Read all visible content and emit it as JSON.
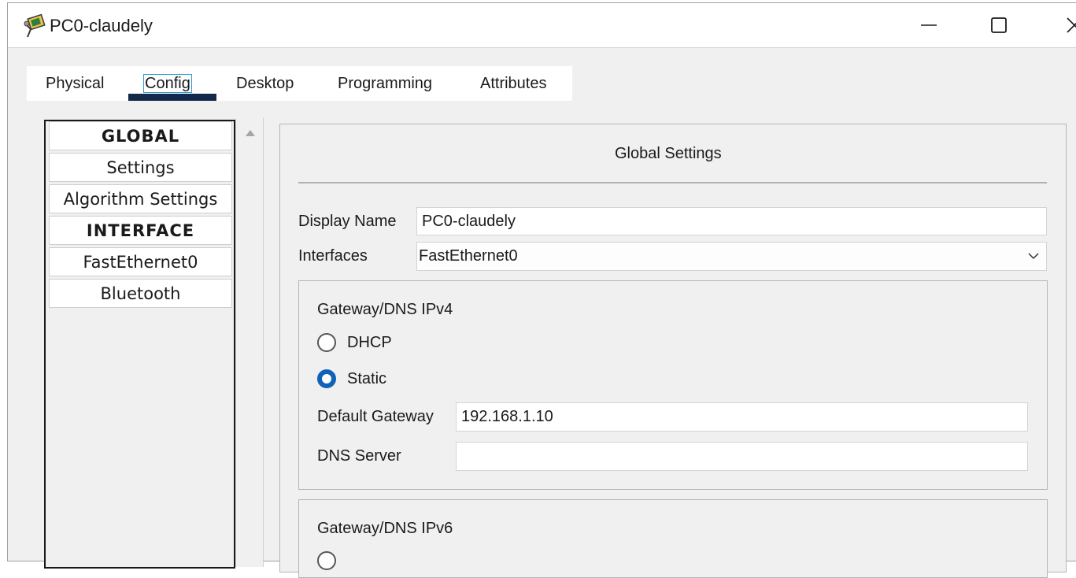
{
  "window": {
    "title": "PC0-claudely"
  },
  "tabs": [
    {
      "label": "Physical",
      "active": false
    },
    {
      "label": "Config",
      "active": true
    },
    {
      "label": "Desktop",
      "active": false
    },
    {
      "label": "Programming",
      "active": false
    },
    {
      "label": "Attributes",
      "active": false
    }
  ],
  "sidebar": {
    "items": [
      {
        "label": "GLOBAL",
        "type": "header"
      },
      {
        "label": "Settings",
        "type": "item"
      },
      {
        "label": "Algorithm Settings",
        "type": "item"
      },
      {
        "label": "INTERFACE",
        "type": "header"
      },
      {
        "label": "FastEthernet0",
        "type": "item"
      },
      {
        "label": "Bluetooth",
        "type": "item"
      }
    ]
  },
  "global_settings": {
    "title": "Global Settings",
    "display_name_label": "Display Name",
    "display_name_value": "PC0-claudely",
    "interfaces_label": "Interfaces",
    "interfaces_selected": "FastEthernet0"
  },
  "ipv4": {
    "title": "Gateway/DNS IPv4",
    "dhcp_label": "DHCP",
    "dhcp_selected": false,
    "static_label": "Static",
    "static_selected": true,
    "gateway_label": "Default Gateway",
    "gateway_value": "192.168.1.10",
    "dns_label": "DNS Server",
    "dns_value": ""
  },
  "ipv6": {
    "title": "Gateway/DNS IPv6"
  },
  "colors": {
    "tab_underline": "#13284a",
    "radio_checked": "#0f62b8",
    "focus_outline": "#2f9bd6"
  }
}
